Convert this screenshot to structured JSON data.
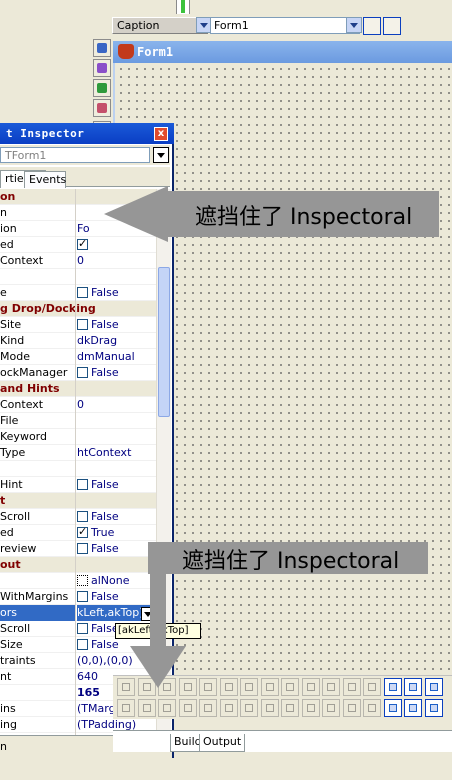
{
  "top_bar": {
    "property_label": "Caption",
    "property_value": "Form1"
  },
  "form": {
    "title": "Form1"
  },
  "inspector": {
    "title": "Inspector",
    "title_prefix": "t",
    "close_glyph": "x",
    "object_combo": "TForm1",
    "tabs": [
      "rties",
      "Events"
    ],
    "rows": [
      {
        "type": "cat",
        "name": "on"
      },
      {
        "type": "prop",
        "name": "n",
        "value": ""
      },
      {
        "type": "prop",
        "name": "ion",
        "value": "Fo"
      },
      {
        "type": "prop",
        "name": "ed",
        "value": "",
        "check": "on"
      },
      {
        "type": "prop",
        "name": "Context",
        "value": "0"
      },
      {
        "type": "prop",
        "name": "",
        "value": ""
      },
      {
        "type": "prop",
        "name": "e",
        "value": "False",
        "check": "off"
      },
      {
        "type": "cat",
        "name": "g Drop/Docking"
      },
      {
        "type": "prop",
        "name": "Site",
        "value": "False",
        "check": "off"
      },
      {
        "type": "prop",
        "name": "Kind",
        "value": "dkDrag"
      },
      {
        "type": "prop",
        "name": "Mode",
        "value": "dmManual"
      },
      {
        "type": "prop",
        "name": "ockManager",
        "value": "False",
        "check": "off"
      },
      {
        "type": "cat",
        "name": " and Hints"
      },
      {
        "type": "prop",
        "name": "Context",
        "value": "0"
      },
      {
        "type": "prop",
        "name": "File",
        "value": ""
      },
      {
        "type": "prop",
        "name": "Keyword",
        "value": ""
      },
      {
        "type": "prop",
        "name": "Type",
        "value": "htContext"
      },
      {
        "type": "prop",
        "name": "",
        "value": ""
      },
      {
        "type": "prop",
        "name": "Hint",
        "value": "False",
        "check": "off"
      },
      {
        "type": "cat",
        "name": "t"
      },
      {
        "type": "prop",
        "name": "Scroll",
        "value": "False",
        "check": "off"
      },
      {
        "type": "prop",
        "name": "ed",
        "value": "True",
        "check": "on"
      },
      {
        "type": "prop",
        "name": "review",
        "value": "False",
        "check": "off"
      },
      {
        "type": "cat",
        "name": "out"
      },
      {
        "type": "prop",
        "name": "",
        "value": "alNone",
        "check": "align"
      },
      {
        "type": "prop",
        "name": "WithMargins",
        "value": "False",
        "check": "off"
      },
      {
        "type": "prop",
        "name": "ors",
        "value": "kLeft,akTop]",
        "selected": true
      },
      {
        "type": "prop",
        "name": "Scroll",
        "value": "False",
        "check": "off"
      },
      {
        "type": "prop",
        "name": "Size",
        "value": "False",
        "check": "off"
      },
      {
        "type": "prop",
        "name": "traints",
        "value": "(0,0),(0,0)"
      },
      {
        "type": "prop",
        "name": "nt",
        "value": "640"
      },
      {
        "type": "prop",
        "name": "",
        "value": "165",
        "bold": true
      },
      {
        "type": "prop",
        "name": "ins",
        "value": "(TMarg"
      },
      {
        "type": "prop",
        "name": "ing",
        "value": "(TPadding)"
      }
    ],
    "status_text": "n",
    "anchors_hint": "[akLeft,akTop]"
  },
  "bottom_tabs": {
    "build": "Build",
    "output": "Output"
  },
  "annotations": {
    "callout_top": "遮挡住了 Inspectoral",
    "callout_bottom": "遮挡住了 Inspectoral",
    "color": "#969696"
  },
  "colors": {
    "title_bar": "#0a3ec4",
    "category_text": "#800000",
    "value_text": "#000080",
    "selection": "#316ac5"
  }
}
